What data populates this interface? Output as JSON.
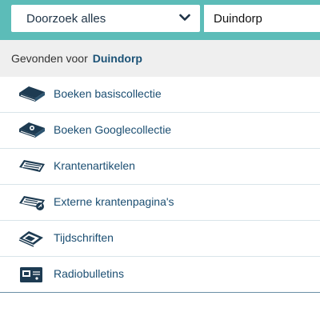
{
  "search": {
    "scope_value": "Doorzoek alles",
    "query_value": "Duindorp"
  },
  "found": {
    "prefix": "Gevonden voor",
    "term": "Duindorp"
  },
  "results": [
    {
      "label": "Boeken basiscollectie",
      "icon": "book-icon"
    },
    {
      "label": "Boeken Googlecollectie",
      "icon": "book-google-icon"
    },
    {
      "label": "Krantenartikelen",
      "icon": "newspaper-icon"
    },
    {
      "label": "Externe krantenpagina's",
      "icon": "external-newspaper-icon"
    },
    {
      "label": "Tijdschriften",
      "icon": "magazine-icon"
    },
    {
      "label": "Radiobulletins",
      "icon": "radio-icon"
    }
  ],
  "colors": {
    "topbar": "#5cbcb8",
    "link": "#1b4e72",
    "icon": "#1d3b52"
  }
}
